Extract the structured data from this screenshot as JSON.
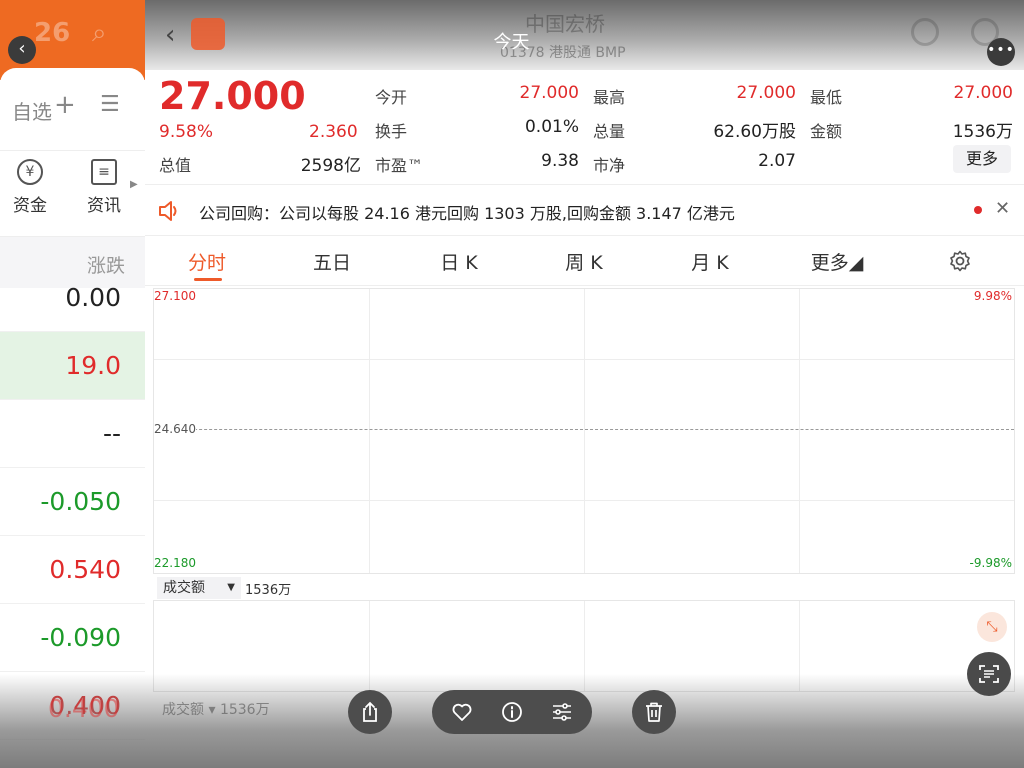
{
  "left": {
    "header_ghost": "26",
    "toolbar_text": "自选",
    "categories": [
      {
        "label": "资金",
        "icon": "yen-icon"
      },
      {
        "label": "资讯",
        "icon": "document-icon"
      }
    ],
    "column_header": "涨跌",
    "quotes": [
      "0.00",
      "19.0",
      "--",
      "-0.050",
      "0.540",
      "-0.090",
      "0.400"
    ]
  },
  "topbar": {
    "title": "今天",
    "ghost_name": "中国宏桥",
    "ghost_code": "01378 港股通 BMP"
  },
  "stock": {
    "price": "27.000",
    "change_pct": "9.58%",
    "change_amt": "2.360",
    "stats": [
      {
        "label": "今开",
        "value": "27.000",
        "color": "#e02b2b"
      },
      {
        "label": "最高",
        "value": "27.000",
        "color": "#e02b2b"
      },
      {
        "label": "最低",
        "value": "27.000",
        "color": "#e02b2b"
      },
      {
        "label": "换手",
        "value": "0.01%",
        "color": "#222222"
      },
      {
        "label": "总量",
        "value": "62.60万股",
        "color": "#222222"
      },
      {
        "label": "金额",
        "value": "1536万",
        "color": "#222222"
      },
      {
        "label": "总值",
        "value": "2598亿",
        "color": "#222222"
      },
      {
        "label": "市盈™",
        "value": "9.38",
        "color": "#222222"
      },
      {
        "label": "市净",
        "value": "2.07",
        "color": "#222222"
      }
    ],
    "more_label": "更多"
  },
  "notice": {
    "text": "公司回购：公司以每股 24.16 港元回购 1303 万股,回购金额 3.147 亿港元",
    "close": "✕"
  },
  "tabs": [
    {
      "label": "分时",
      "active": true
    },
    {
      "label": "五日",
      "active": false
    },
    {
      "label": "日 K",
      "active": false
    },
    {
      "label": "周 K",
      "active": false
    },
    {
      "label": "月 K",
      "active": false
    },
    {
      "label": "更多◢",
      "active": false
    }
  ],
  "chart": {
    "y_top": "27.100",
    "y_mid": "24.640",
    "y_bottom": "22.180",
    "pct_top": "9.98%",
    "pct_bottom": "-9.98%"
  },
  "volume": {
    "selector": "成交额",
    "value": "1536万",
    "ghost_selector": "成交额",
    "ghost_value": "1536万"
  },
  "colors": {
    "up": "#e02b2b",
    "down": "#1c9a2a",
    "accent": "#ee5a2a"
  }
}
